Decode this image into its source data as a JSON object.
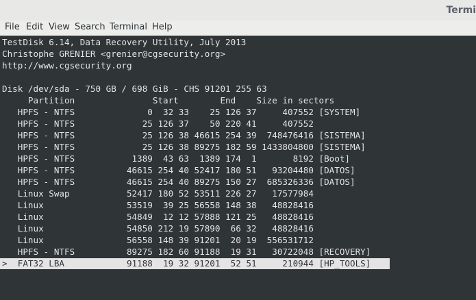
{
  "window": {
    "title": "Termi"
  },
  "menu": [
    "File",
    "Edit",
    "View",
    "Search",
    "Terminal",
    "Help"
  ],
  "terminal": {
    "lines": [
      "TestDisk 6.14, Data Recovery Utility, July 2013",
      "Christophe GRENIER <grenier@cgsecurity.org>",
      "http://www.cgsecurity.org",
      "",
      "Disk /dev/sda - 750 GB / 698 GiB - CHS 91201 255 63",
      "     Partition               Start        End    Size in sectors",
      "   HPFS - NTFS              0  32 33    25 126 37     407552 [SYSTEM]",
      "   HPFS - NTFS             25 126 37    50 220 41     407552",
      "   HPFS - NTFS             25 126 38 46615 254 39  748476416 [SISTEMA]",
      "   HPFS - NTFS             25 126 38 89275 182 59 1433804800 [SISTEMA]",
      "   HPFS - NTFS           1389  43 63  1389 174  1       8192 [Boot]",
      "   HPFS - NTFS          46615 254 40 52417 180 51   93204480 [DATOS]",
      "   HPFS - NTFS          46615 254 40 89275 150 27  685326336 [DATOS]",
      "   Linux Swap           52417 180 52 53511 226 27   17577984",
      "   Linux                53519  39 25 56558 148 38   48828416",
      "   Linux                54849  12 12 57888 121 25   48828416",
      "   Linux                54850 212 19 57890  66 32   48828416",
      "   Linux                56558 148 39 91201  20 19  556531712",
      "   HPFS - NTFS          89275 182 60 91188  19 31   30722048 [RECOVERY]",
      ">  FAT32 LBA            91188  19 32 91201  52 51     210944 [HP_TOOLS]"
    ]
  }
}
